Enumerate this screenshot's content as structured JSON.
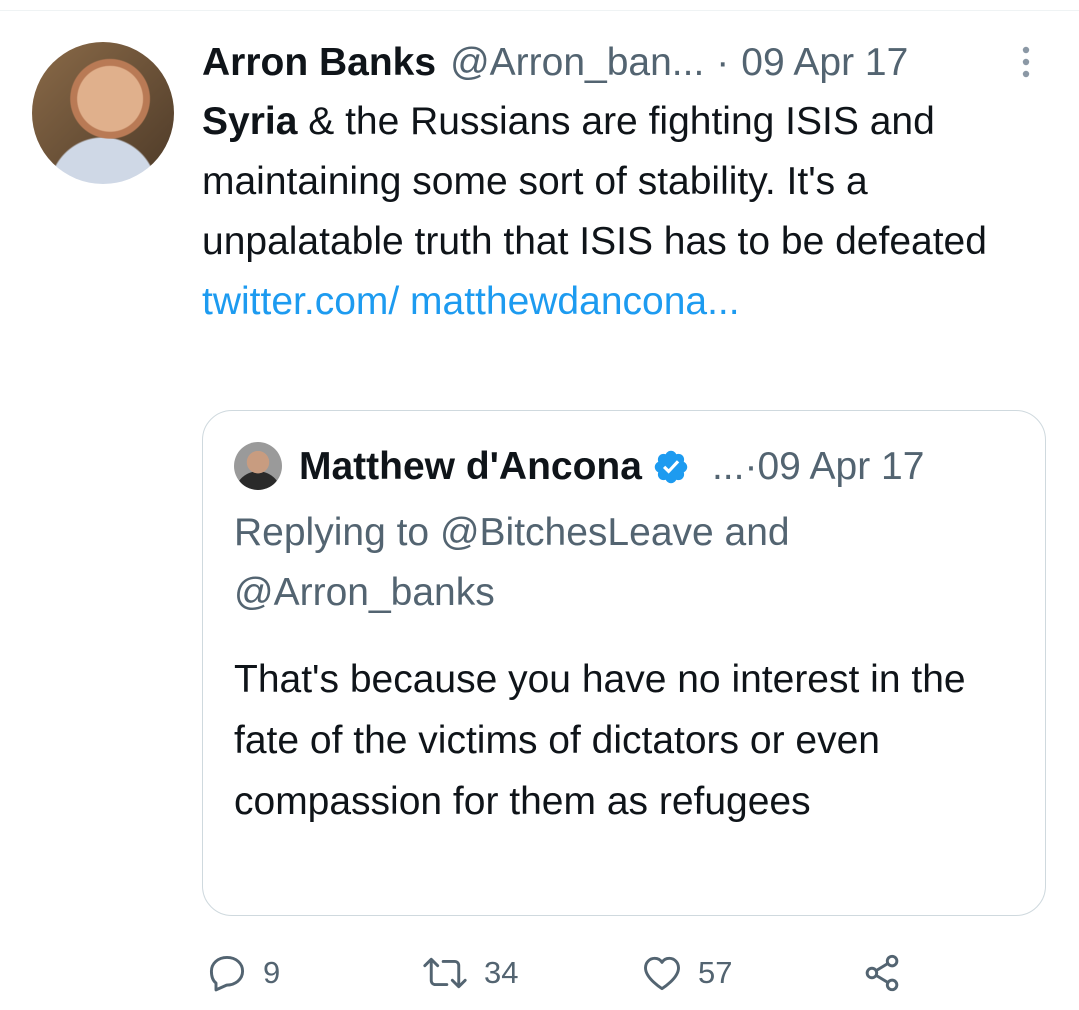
{
  "tweet": {
    "author_name": "Arron Banks",
    "author_handle": "@Arron_ban...",
    "separator": "·",
    "date": "09 Apr 17",
    "text_bold": "Syria",
    "text_body": " & the Russians are fighting ISIS and maintaining some sort of stability. It's a unpalatable truth that ISIS has to be defeated ",
    "link_text": "twitter.com/ matthewdancona..."
  },
  "quoted_tweet": {
    "author_name": "Matthew d'Ancona",
    "ellipsis": "...·",
    "date": "09 Apr 17",
    "replying_to": "Replying to @BitchesLeave and @Arron_banks",
    "text": "That's because you have no interest in the fate of the victims of dictators or even compassion for them as refugees"
  },
  "actions": {
    "reply_count": "9",
    "retweet_count": "34",
    "like_count": "57"
  },
  "colors": {
    "link": "#1d9bf0",
    "secondary_text": "#536471",
    "border": "#cfd9de",
    "verified": "#1d9bf0"
  },
  "icons": [
    "more-vertical-icon",
    "verified-badge-icon",
    "reply-icon",
    "retweet-icon",
    "like-icon",
    "share-icon"
  ]
}
